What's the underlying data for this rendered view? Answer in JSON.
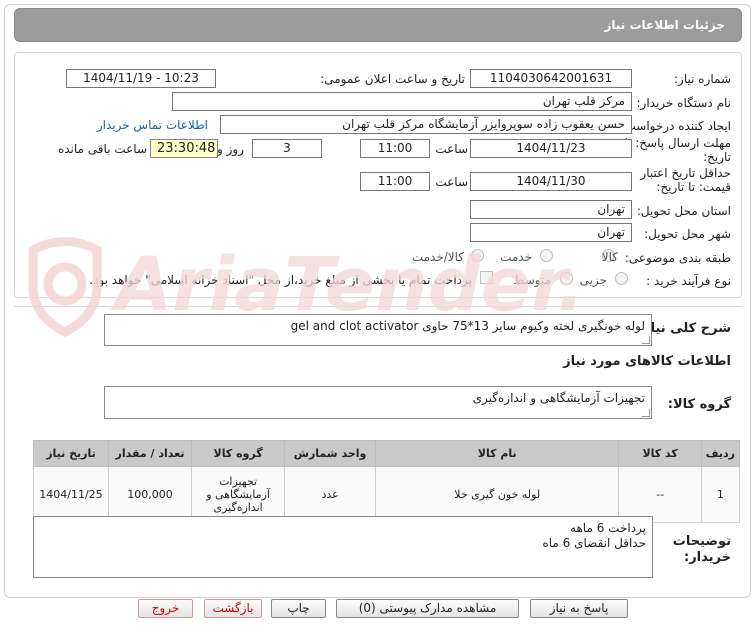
{
  "page_title": "جزئیات اطلاعات نیاز",
  "form": {
    "need_number_label": "شماره نیاز:",
    "need_number": "1104030642001631",
    "announce_label": "تاریخ و ساعت اعلان عمومی:",
    "announce_value": "1404/11/19 - 10:23",
    "buyer_org_label": "نام دستگاه خریدار:",
    "buyer_org": "مرکز قلب تهران",
    "requester_label": "ایجاد کننده درخواست:",
    "requester": "حسن یعقوب زاده سوپروایزر آزمایشگاه مرکز قلب تهران",
    "contact_link": "اطلاعات تماس خریدار",
    "deadline_label_1": "مهلت ارسال پاسخ: تا",
    "deadline_label_2": "تاریخ:",
    "deadline_date": "1404/11/23",
    "time_label": "ساعت",
    "deadline_time": "11:00",
    "days_value": "3",
    "days_label": "روز و",
    "remaining_time": "23:30:48",
    "remaining_label": "ساعت باقی مانده",
    "validity_label_1": "حداقل تاریخ اعتبار",
    "validity_label_2": "قیمت: تا تاریخ:",
    "validity_date": "1404/11/30",
    "validity_time": "11:00",
    "province_label": "استان محل تحویل:",
    "province": "تهران",
    "city_label": "شهر محل تحویل:",
    "city": "تهران",
    "category_label": "طبقه بندی موضوعی:",
    "category_options": [
      "کالا",
      "خدمت",
      "کالا/خدمت"
    ],
    "process_label": "نوع فرآیند خرید :",
    "process_options": [
      "جزیی",
      "متوسط"
    ],
    "payment_note": "پرداخت تمام یا بخشی از مبلغ خرید،از محل \"اسناد خزانه اسلامی\" خواهد بود."
  },
  "need_summary_label": "شرح کلی نیاز:",
  "need_summary": "لوله خونگیری لخته وکیوم سایز 13*75 حاوی gel and clot activator",
  "goods_info_title": "اطلاعات کالاهای مورد نیاز",
  "goods_group_label": "گروه کالا:",
  "goods_group": "تجهیزات آزمایشگاهی و اندازه‌گیری",
  "table": {
    "headers": [
      "ردیف",
      "کد کالا",
      "نام کالا",
      "واحد شمارش",
      "گروه کالا",
      "تعداد / مقدار",
      "تاریخ نیاز"
    ],
    "rows": [
      [
        "1",
        "--",
        "لوله خون گیری خلا",
        "عدد",
        "تجهیزات آزمایشگاهی و اندازه‌گیری",
        "100,000",
        "1404/11/25"
      ]
    ]
  },
  "buyer_notes_label_1": "توضیحات",
  "buyer_notes_label_2": "خریدار:",
  "buyer_notes": [
    "پرداخت 6 ماهه",
    "حداقل انقضای 6 ماه"
  ],
  "buttons": {
    "reply": "پاسخ به نیاز",
    "attachments": "مشاهده مدارک پیوستی (0)",
    "print": "چاپ",
    "back": "بازگشت",
    "exit": "خروج"
  },
  "watermark_text": "AriaTender.net",
  "colors": {
    "title_bg": "#9c9c9c",
    "link": "#1a5fb4",
    "remaining_bg": "#ffffcc",
    "table_header_bg": "#c9c9c9",
    "exit_text": "#cc0000"
  }
}
